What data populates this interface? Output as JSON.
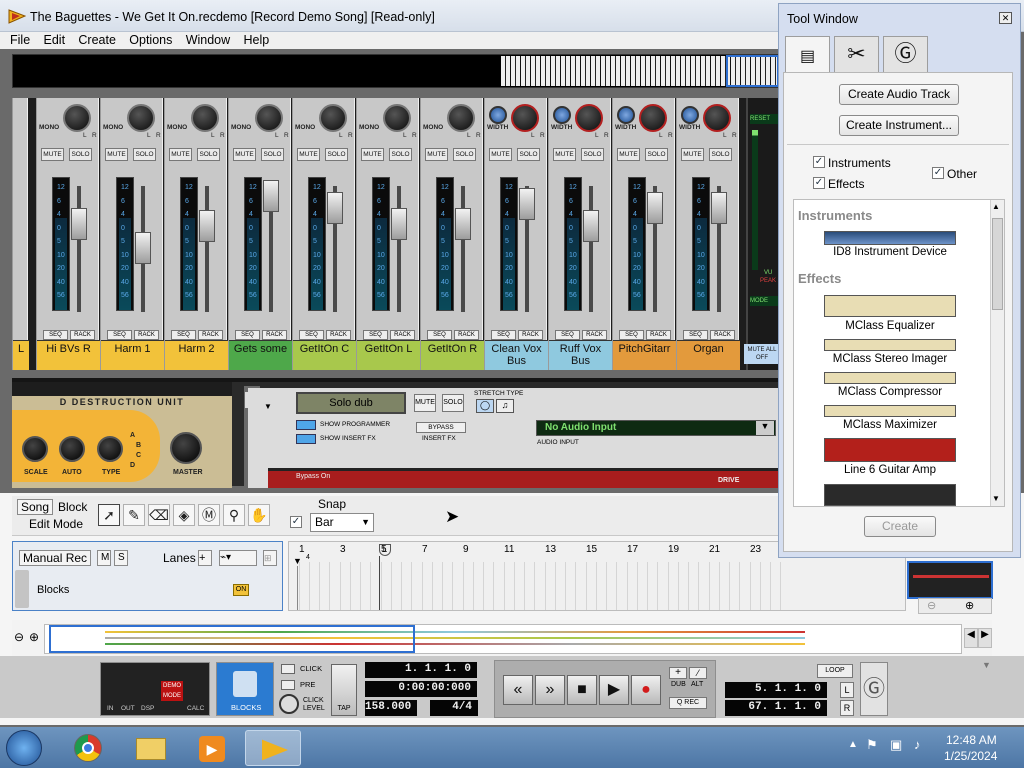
{
  "window": {
    "title": "The Baguettes - We Get It On.recdemo [Record Demo Song] [Read-only]"
  },
  "menu": [
    "File",
    "Edit",
    "Create",
    "Options",
    "Window",
    "Help"
  ],
  "mixer": {
    "first_strip_name": "L",
    "channels": [
      {
        "name": "Hi BVs R",
        "color": "#f2c23a"
      },
      {
        "name": "Harm 1",
        "color": "#f2c23a"
      },
      {
        "name": "Harm 2",
        "color": "#f2c23a"
      },
      {
        "name": "Gets some",
        "color": "#4ea84a"
      },
      {
        "name": "GetItOn C",
        "color": "#a8c84c"
      },
      {
        "name": "GetItOn L",
        "color": "#a8c84c"
      },
      {
        "name": "GetItOn R",
        "color": "#a8c84c"
      },
      {
        "name": "Clean Vox Bus",
        "color": "#8fc9df"
      },
      {
        "name": "Ruff Vox Bus",
        "color": "#8fc9df"
      },
      {
        "name": "PitchGitarr",
        "color": "#e39a3c"
      },
      {
        "name": "Organ",
        "color": "#e39a3c"
      }
    ],
    "mono_label": "MONO",
    "width_label": "WIDTH",
    "mute_label": "MUTE",
    "solo_label": "SOLO",
    "seq_label": "SEQ",
    "rack_label": "RACK",
    "meter_scale": [
      "12",
      "6",
      "4",
      "0",
      "5",
      "10",
      "20",
      "40",
      "56"
    ],
    "master_labels": {
      "reset": "RESET",
      "mode": "MODE",
      "vu": "VU",
      "peak": "PEAK",
      "mute_all_off": "MUTE ALL OFF"
    }
  },
  "rack": {
    "device_title": "D DESTRUCTION UNIT",
    "knobs": [
      "SCALE",
      "AUTO",
      "TYPE",
      "MASTER"
    ],
    "type_letters": [
      "A",
      "B",
      "C",
      "D"
    ],
    "solo_dub": "Solo dub",
    "mute": "MUTE",
    "solo": "SOLO",
    "show_programmer": "SHOW PROGRAMMER",
    "show_insert_fx": "SHOW INSERT FX",
    "bypass": "BYPASS",
    "insert_fx": "INSERT FX",
    "stretch_type": "STRETCH TYPE",
    "audio_input_value": "No Audio Input",
    "audio_input_label": "AUDIO INPUT",
    "drive": "DRIVE",
    "bypass_on": "Bypass On"
  },
  "sequencer_toolbar": {
    "song": "Song",
    "block": "Block",
    "edit_mode": "Edit Mode",
    "snap_label": "Snap",
    "snap_value": "Bar"
  },
  "track": {
    "manual_rec": "Manual Rec",
    "m": "M",
    "s": "S",
    "lanes": "Lanes",
    "name": "Blocks",
    "on_badge": "ON"
  },
  "ruler": {
    "marks": [
      "1",
      "3",
      "5",
      "7",
      "9",
      "11",
      "13",
      "15",
      "17",
      "19",
      "21",
      "23"
    ],
    "sub_mark": "4",
    "locator": "L"
  },
  "transport": {
    "click": "CLICK",
    "pre": "PRE",
    "click_level": "CLICK LEVEL",
    "tap": "TAP",
    "blocks": "BLOCKS",
    "in": "IN",
    "out": "OUT",
    "dsp": "DSP",
    "calc": "CALC",
    "demo_mode": "DEMO MODE",
    "position": "1. 1. 1.   0",
    "time": "0:00:00:000",
    "tempo": "158.000",
    "signature": "4/4",
    "dub": "DUB",
    "alt": "ALT",
    "q_rec": "Q REC",
    "loop": "LOOP",
    "left_locator": "5. 1. 1.   0",
    "right_locator": "67. 1. 1.   0",
    "l": "L",
    "r": "R"
  },
  "tool_window": {
    "title": "Tool Window",
    "create_audio_track": "Create Audio Track",
    "create_instrument": "Create Instrument...",
    "filters": [
      {
        "label": "Instruments",
        "checked": true
      },
      {
        "label": "Effects",
        "checked": true
      },
      {
        "label": "Other",
        "checked": true
      }
    ],
    "instruments_header": "Instruments",
    "effects_header": "Effects",
    "instruments": [
      "ID8 Instrument Device"
    ],
    "effects": [
      "MClass Equalizer",
      "MClass Stereo Imager",
      "MClass Compressor",
      "MClass Maximizer",
      "Line 6 Guitar Amp"
    ],
    "create_button": "Create"
  },
  "taskbar": {
    "time": "12:48 AM",
    "date": "1/25/2024"
  }
}
